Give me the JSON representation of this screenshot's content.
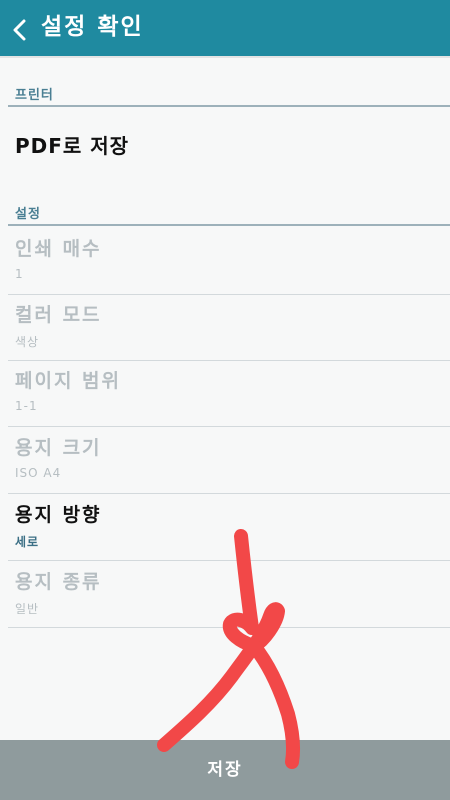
{
  "header": {
    "title": "설정 확인",
    "back_icon": "chevron-left-icon",
    "color": "#1f8aa0"
  },
  "printer_section": {
    "label": "프린터",
    "printer_name": "PDF로 저장"
  },
  "settings_section": {
    "label": "설정",
    "items": [
      {
        "title": "인쇄 매수",
        "value": "1",
        "highlighted": false
      },
      {
        "title": "컬러 모드",
        "value": "색상",
        "highlighted": false
      },
      {
        "title": "페이지 범위",
        "value": "1-1",
        "highlighted": false
      },
      {
        "title": "용지 크기",
        "value": "ISO A4",
        "highlighted": false
      },
      {
        "title": "용지 방향",
        "value": "세로",
        "highlighted": true
      },
      {
        "title": "용지 종류",
        "value": "일반",
        "highlighted": false
      }
    ]
  },
  "footer": {
    "save_label": "저장",
    "color": "#8f9b9d"
  },
  "annotation": {
    "type": "hand-drawn-arrow",
    "color": "#f24848"
  }
}
